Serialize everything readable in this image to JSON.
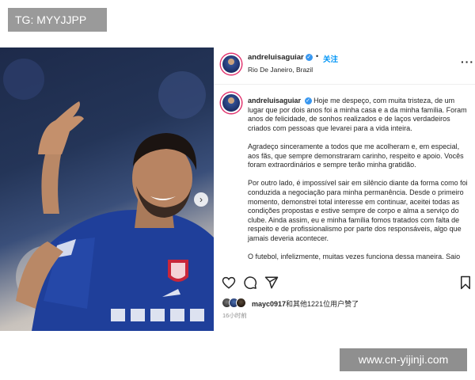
{
  "watermark_top": "TG: MYYJJPP",
  "watermark_bottom": "www.cn-yijinji.com",
  "post": {
    "username": "andreluisaguiar",
    "verified_glyph": "✓",
    "dot": "•",
    "follow_label": "关注",
    "location": "Rio De Janeiro, Brazil",
    "more_label": "···",
    "caption_username": "andreluisaguiar",
    "caption_paragraphs": [
      "Hoje me despeço, com muita tristeza, de um lugar que por dois anos foi a minha casa e a da minha família. Foram anos de felicidade, de sonhos realizados e de laços verdadeiros criados com pessoas que levarei para a vida inteira.",
      "Agradeço sinceramente a todos que me acolheram e, em especial, aos fãs, que sempre demonstraram carinho, respeito e apoio. Vocês foram extraordinários e sempre terão minha gratidão.",
      "Por outro lado, é impossível sair em silêncio diante da forma como foi conduzida a negociação para minha permanência. Desde o primeiro momento, demonstrei total interesse em continuar, aceitei todas as condições propostas e estive sempre de corpo e alma a serviço do clube. Ainda assim, eu e minha família fomos tratados com falta de respeito e de profissionalismo por parte dos responsáveis, algo que jamais deveria acontecer.",
      "O futebol, infelizmente, muitas vezes funciona dessa maneira. Saio"
    ],
    "likes_user": "mayc0917",
    "likes_rest": "和其他1221位用户赞了",
    "time_ago": "16小时前",
    "next_arrow": "›"
  },
  "icons": [
    "heart-icon",
    "comment-icon",
    "share-icon",
    "bookmark-icon"
  ],
  "colors": {
    "verified": "#3897f0",
    "follow": "#0095f6",
    "jersey": "#1f3f9a"
  }
}
